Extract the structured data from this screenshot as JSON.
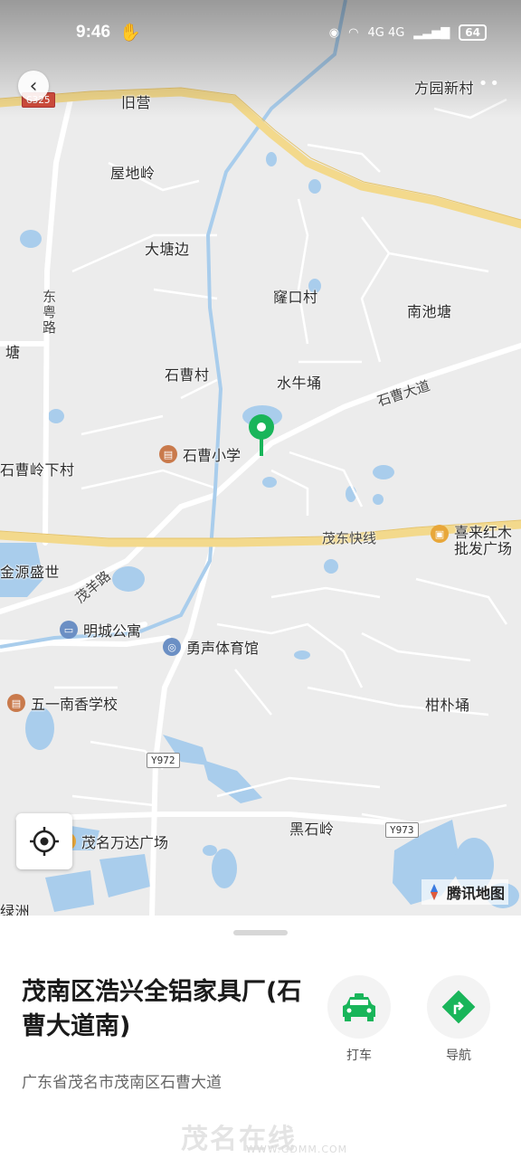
{
  "status_bar": {
    "time": "9:46",
    "network": "4G 4G",
    "battery": "64"
  },
  "map": {
    "places": [
      {
        "id": "jiuying",
        "label": "旧营"
      },
      {
        "id": "fangyuan",
        "label": "方园新村"
      },
      {
        "id": "wudiling",
        "label": "屋地岭"
      },
      {
        "id": "datangbian",
        "label": "大塘边"
      },
      {
        "id": "longkou",
        "label": "窿口村"
      },
      {
        "id": "nanchitang",
        "label": "南池塘"
      },
      {
        "id": "tianglabel",
        "label": "塘"
      },
      {
        "id": "shicaocun",
        "label": "石曹村"
      },
      {
        "id": "shuiniuyong",
        "label": "水牛埇"
      },
      {
        "id": "shicaolingxia",
        "label": "石曹岭下村"
      },
      {
        "id": "jinyuan",
        "label": "金源盛世"
      },
      {
        "id": "ganpuyong",
        "label": "柑朴埇"
      },
      {
        "id": "heishiling",
        "label": "黑石岭"
      },
      {
        "id": "lvzhou",
        "label": "绿洲"
      }
    ],
    "roads": [
      {
        "id": "dongyue",
        "label": "东粤路"
      },
      {
        "id": "shicaodadao",
        "label": "石曹大道"
      },
      {
        "id": "maodong",
        "label": "茂东快线"
      },
      {
        "id": "maoyang",
        "label": "茂羊路"
      }
    ],
    "shields": [
      {
        "id": "g325",
        "label": "G325"
      },
      {
        "id": "y972",
        "label": "Y972"
      },
      {
        "id": "y973",
        "label": "Y973"
      }
    ],
    "pois": [
      {
        "id": "school1",
        "label": "石曹小学",
        "icon": "school-icon"
      },
      {
        "id": "hotel",
        "label": "明城公寓",
        "icon": "hotel-icon"
      },
      {
        "id": "gym",
        "label": "勇声体育馆",
        "icon": "stadium-icon"
      },
      {
        "id": "school2",
        "label": "五一南香学校",
        "icon": "school-icon"
      },
      {
        "id": "wanda",
        "label": "茂名万达广场",
        "icon": "mall-icon"
      },
      {
        "id": "xilai",
        "label": "喜来红木",
        "label2": "批发广场",
        "icon": "mall-icon"
      }
    ],
    "brand": "腾讯地图"
  },
  "place": {
    "title": "茂南区浩兴全铝家具厂(石曹大道南)",
    "address": "广东省茂名市茂南区石曹大道"
  },
  "actions": {
    "taxi": "打车",
    "navigate": "导航"
  },
  "watermark": {
    "logo": "茂名在线",
    "url": "WWW.GDMM.COM"
  },
  "colors": {
    "accent": "#19b55a",
    "highway": "#f3d98c",
    "water": "#a9cdec"
  }
}
